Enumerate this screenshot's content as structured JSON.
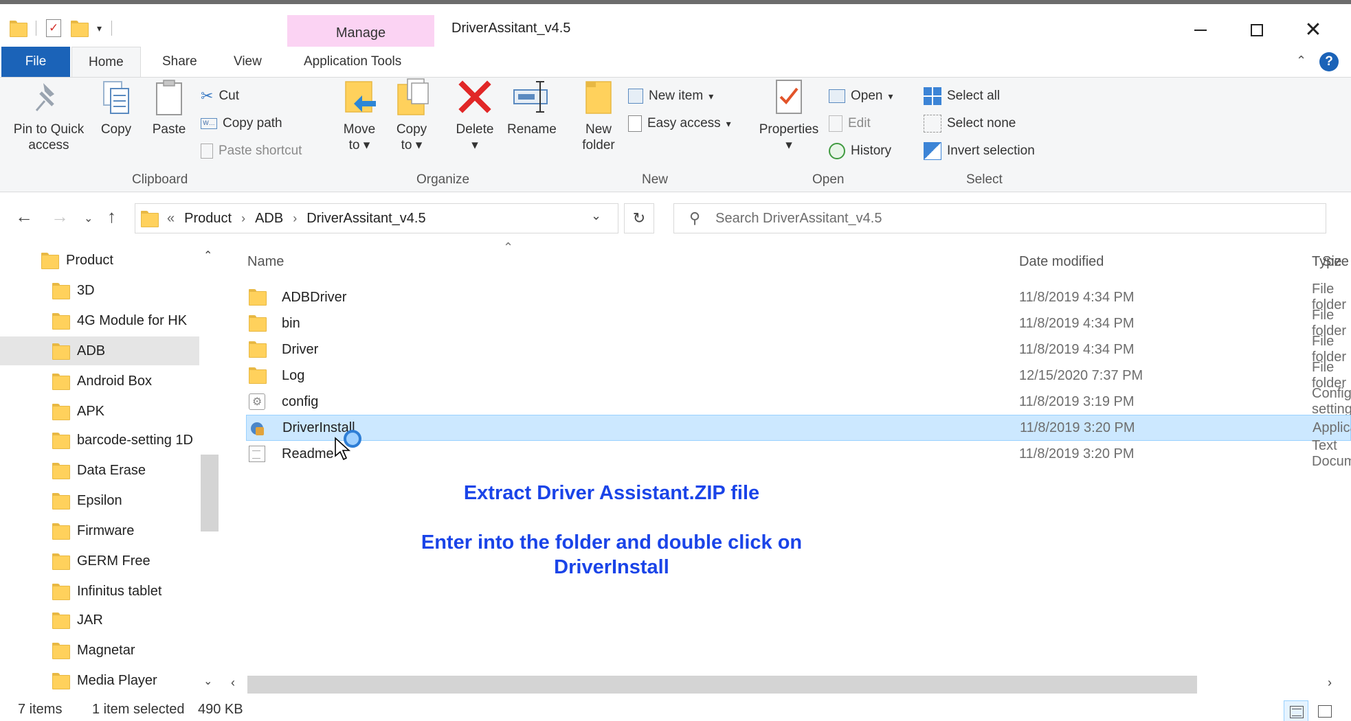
{
  "window": {
    "title": "DriverAssitant_v4.5",
    "context_tab": "Manage"
  },
  "tabs": [
    "File",
    "Home",
    "Share",
    "View",
    "Application Tools"
  ],
  "ribbon": {
    "clipboard": {
      "label": "Clipboard",
      "pin": "Pin to Quick",
      "pin2": "access",
      "copy": "Copy",
      "paste": "Paste",
      "cut": "Cut",
      "copy_path": "Copy path",
      "paste_shortcut": "Paste shortcut"
    },
    "organize": {
      "label": "Organize",
      "move": "Move",
      "move2": "to",
      "copy": "Copy",
      "copy2": "to",
      "delete": "Delete",
      "rename": "Rename"
    },
    "new": {
      "label": "New",
      "new_folder": "New",
      "new_folder2": "folder",
      "new_item": "New item",
      "easy_access": "Easy access"
    },
    "open": {
      "label": "Open",
      "properties": "Properties",
      "open": "Open",
      "edit": "Edit",
      "history": "History"
    },
    "select": {
      "label": "Select",
      "select_all": "Select all",
      "select_none": "Select none",
      "invert": "Invert selection"
    }
  },
  "address": {
    "prefix": "«",
    "crumbs": [
      "Product",
      "ADB",
      "DriverAssitant_v4.5"
    ],
    "search_placeholder": "Search DriverAssitant_v4.5"
  },
  "nav_tree": [
    "Product",
    "3D",
    "4G Module for HK",
    "ADB",
    "Android Box",
    "APK",
    "barcode-setting 1D",
    "Data Erase",
    "Epsilon",
    "Firmware",
    "GERM Free",
    "Infinitus tablet",
    "JAR",
    "Magnetar",
    "Media Player"
  ],
  "columns": {
    "name": "Name",
    "date": "Date modified",
    "type": "Type",
    "size": "Size"
  },
  "files": [
    {
      "name": "ADBDriver",
      "date": "11/8/2019 4:34 PM",
      "type": "File folder",
      "icon": "folder-icon"
    },
    {
      "name": "bin",
      "date": "11/8/2019 4:34 PM",
      "type": "File folder",
      "icon": "folder-icon"
    },
    {
      "name": "Driver",
      "date": "11/8/2019 4:34 PM",
      "type": "File folder",
      "icon": "folder-icon"
    },
    {
      "name": "Log",
      "date": "12/15/2020 7:37 PM",
      "type": "File folder",
      "icon": "folder-icon"
    },
    {
      "name": "config",
      "date": "11/8/2019 3:19 PM",
      "type": "Configuration settings",
      "icon": "config-file-icon"
    },
    {
      "name": "DriverInstall",
      "date": "11/8/2019 3:20 PM",
      "type": "Application",
      "icon": "application-icon"
    },
    {
      "name": "Readme",
      "date": "11/8/2019 3:20 PM",
      "type": "Text Document",
      "icon": "text-document-icon"
    }
  ],
  "notes": {
    "line1": "Extract Driver Assistant.ZIP file",
    "line2": "Enter into the folder and double click on",
    "line3": "DriverInstall"
  },
  "status": {
    "items": "7 items",
    "selected": "1 item selected",
    "size": "490 KB"
  },
  "colors": {
    "accent": "#1b63b8",
    "manage_tab": "#fbd3f3",
    "selection": "#cce8ff",
    "note_text": "#1a44e8"
  }
}
